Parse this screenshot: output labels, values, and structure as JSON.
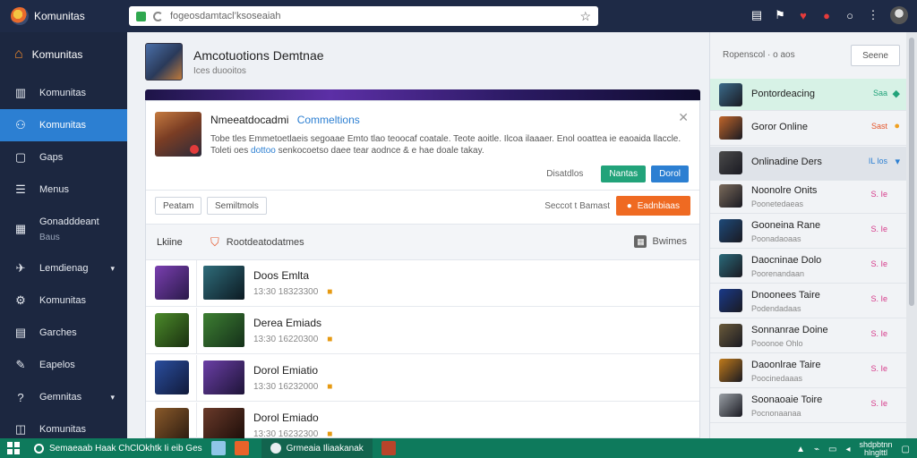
{
  "browser": {
    "brand": "Komunitas",
    "url": "fogeosdamtacl’ksoseaiah",
    "colors": {
      "topbar": "#1e2a46",
      "accent": "#2c7fd2"
    }
  },
  "sidebar": {
    "header": "Komunitas",
    "items": [
      {
        "label": "Komunitas",
        "icon": "bar-chart-icon"
      },
      {
        "label": "Komunitas",
        "icon": "users-icon",
        "active": true
      },
      {
        "label": "Gaps",
        "icon": "window-icon"
      },
      {
        "label": "Menus",
        "icon": "list-icon"
      },
      {
        "label": "Gonadddeant",
        "sub": "Baus",
        "icon": "grid-icon"
      },
      {
        "label": "Lemdienag",
        "icon": "twitter-icon",
        "caret": "▾"
      },
      {
        "label": "Komunitas",
        "icon": "gear-icon"
      },
      {
        "label": "Garches",
        "icon": "document-icon"
      },
      {
        "label": "Eapelos",
        "icon": "tools-icon"
      },
      {
        "label": "Gemnitas",
        "icon": "help-icon",
        "caret": "▾"
      },
      {
        "label": "Komunitas",
        "icon": "apps-icon"
      }
    ]
  },
  "main": {
    "title": "Amcotuotions Demtnae",
    "subtitle": "Ices duooitos",
    "notice": {
      "title": "Nmeeatdocadmi",
      "title_accent": "Commeltions",
      "body_1": "Tobe tles Emmetoetlaeis segoaae Emto tlao teoocaf coatale. Teote aoitle. Ilcoa ilaaaer. Enol ooattea ie eaoaida llaccle. Toleti oes",
      "body_hl": "dottoo",
      "body_2": "senkocoetso daee tear aodnce & e hae doale takay.",
      "link": "Disatdlos",
      "btn_green": "Nantas",
      "btn_blue": "Dorol"
    },
    "filters": {
      "btn1": "Peatam",
      "btn2": "Semiltmols",
      "sort": "Seccot t Bamast",
      "primary": "Eadnbiaas"
    },
    "list_head": {
      "left": "Lkiine",
      "mid": "Rootdeatodatmes",
      "right": "Bwimes"
    },
    "rows": [
      {
        "title": "Doos Emlta",
        "meta": "13:30 18323300",
        "icon_color": "#7a3fb0",
        "thumb_color": "#2f6c7a"
      },
      {
        "title": "Derea Emiads",
        "meta": "13:30 16220300",
        "icon_color": "#4b8a2a",
        "thumb_color": "#3d7f32"
      },
      {
        "title": "Dorol Emiatio",
        "meta": "13:30 16232000",
        "icon_color": "#2a4e9e",
        "thumb_color": "#6b3fa6"
      },
      {
        "title": "Dorol Emiado",
        "meta": "13:30 16232300",
        "icon_color": "#8a5a2a",
        "thumb_color": "#6a3a2a"
      }
    ]
  },
  "rpanel": {
    "link": "Ropenscol · o aos",
    "button": "Seene",
    "items": [
      {
        "name": "Pontordeacing",
        "sub": "",
        "tag": "Saa",
        "tag_color": "#22a37a",
        "badge": "◆",
        "badge_color": "#22a37a",
        "style": "green",
        "icon_color": "#3a6a8a"
      },
      {
        "name": "Goror Online",
        "sub": "",
        "tag": "Sast",
        "tag_color": "#e4552a",
        "badge": "●",
        "badge_color": "#f0a020",
        "style": "",
        "icon_color": "#c0652a"
      },
      {
        "name": "Onlinadine Ders",
        "sub": "",
        "tag": "IL los",
        "tag_color": "#2c7fd2",
        "badge": "▾",
        "badge_color": "#2c7fd2",
        "style": "gray",
        "icon_color": "#4a4a4a"
      },
      {
        "name": "Noonolre Onits",
        "sub": "Poonetedaeas",
        "tag": "S. Ie",
        "tag_color": "#d63a8a",
        "badge": "",
        "badge_color": "",
        "style": "",
        "icon_color": "#7a6a5a"
      },
      {
        "name": "Gooneina Rane",
        "sub": "Poonadaoaas",
        "tag": "S. Ie",
        "tag_color": "#d63a8a",
        "badge": "",
        "badge_color": "",
        "style": "",
        "icon_color": "#1e4a7a"
      },
      {
        "name": "Daocninae Dolo",
        "sub": "Poorenandaan",
        "tag": "S. Ie",
        "tag_color": "#d63a8a",
        "badge": "",
        "badge_color": "",
        "style": "",
        "icon_color": "#2a6a7a"
      },
      {
        "name": "Dnoonees Taire",
        "sub": "Podendadaas",
        "tag": "S. Ie",
        "tag_color": "#d63a8a",
        "badge": "",
        "badge_color": "",
        "style": "",
        "icon_color": "#1a3a8a"
      },
      {
        "name": "Sonnanrae Doine",
        "sub": "Pooonoe Ohlo",
        "tag": "S. Ie",
        "tag_color": "#d63a8a",
        "badge": "",
        "badge_color": "",
        "style": "",
        "icon_color": "#6a5a3a"
      },
      {
        "name": "Daoonlrae Taire",
        "sub": "Poocinedaaas",
        "tag": "S. Ie",
        "tag_color": "#d63a8a",
        "badge": "",
        "badge_color": "",
        "style": "",
        "icon_color": "#c07a1a"
      },
      {
        "name": "Soonaoaie Toire",
        "sub": "Pocnonaanaa",
        "tag": "S. Ie",
        "tag_color": "#d63a8a",
        "badge": "",
        "badge_color": "",
        "style": "",
        "icon_color": "#9aa0a6"
      }
    ]
  },
  "taskbar": {
    "search": "Semaeaab Haak ChClOkhtk  Ii eib  Ges",
    "active_app": "Grmeaia Iliaakanak",
    "clock_1": "shdpbtnn",
    "clock_2": "hlnglttl"
  }
}
